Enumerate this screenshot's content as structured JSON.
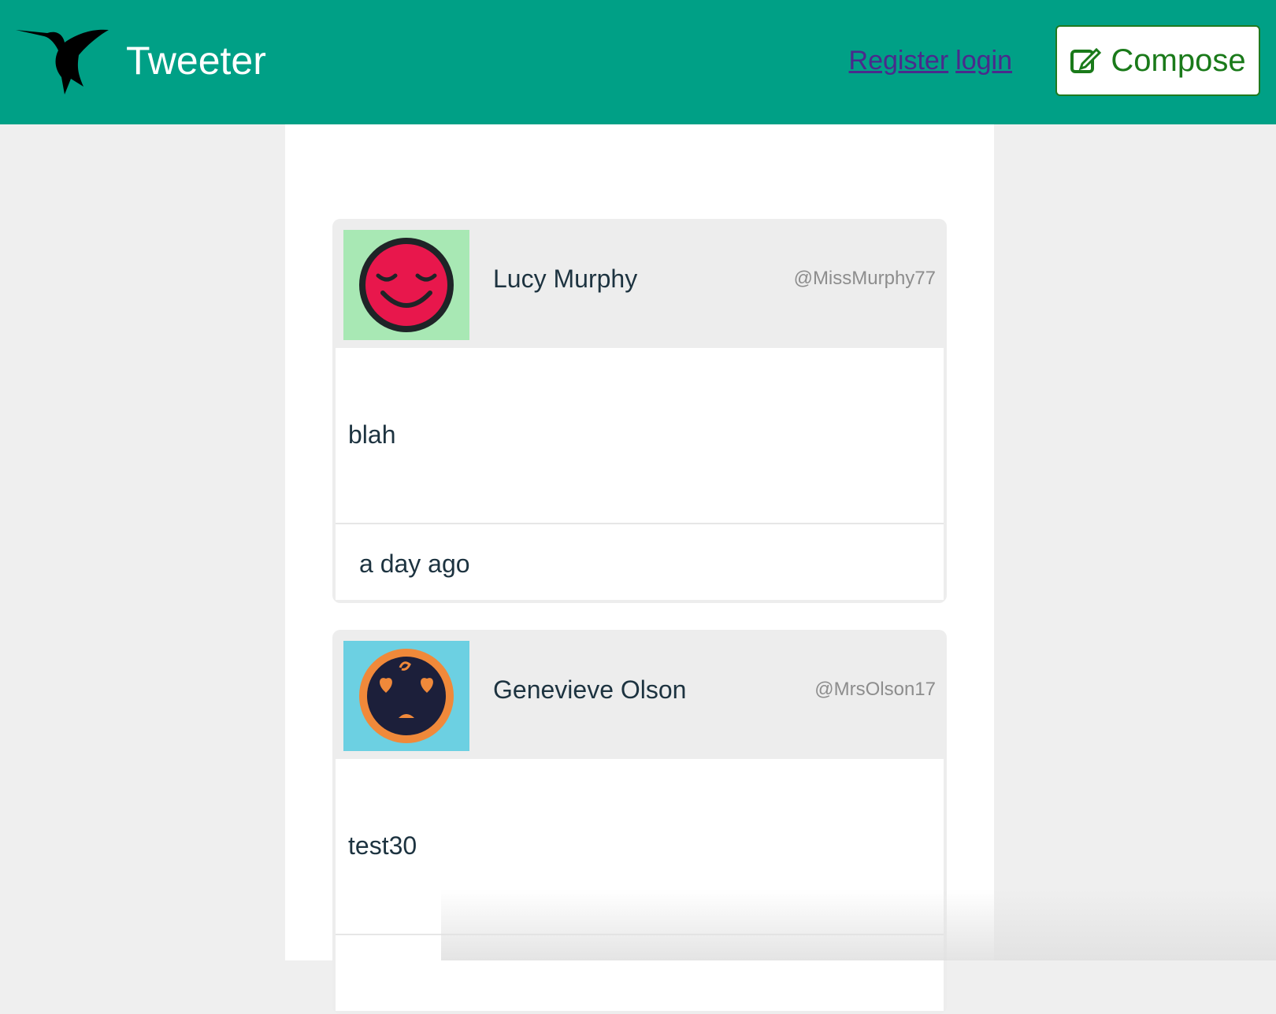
{
  "header": {
    "brand": "Tweeter",
    "register_label": "Register",
    "login_label": "login",
    "compose_label": "Compose",
    "bg_color": "#00a086"
  },
  "tweets": [
    {
      "name": "Lucy Murphy",
      "handle": "@MissMurphy77",
      "text": "blah",
      "time": "a day ago",
      "avatar_icon": "smiling-face-icon",
      "avatar_bg": "#a8e8b4"
    },
    {
      "name": "Genevieve Olson",
      "handle": "@MrsOlson17",
      "text": "test30",
      "time": "",
      "avatar_icon": "heart-eyes-face-icon",
      "avatar_bg": "#6cd0e2"
    }
  ]
}
